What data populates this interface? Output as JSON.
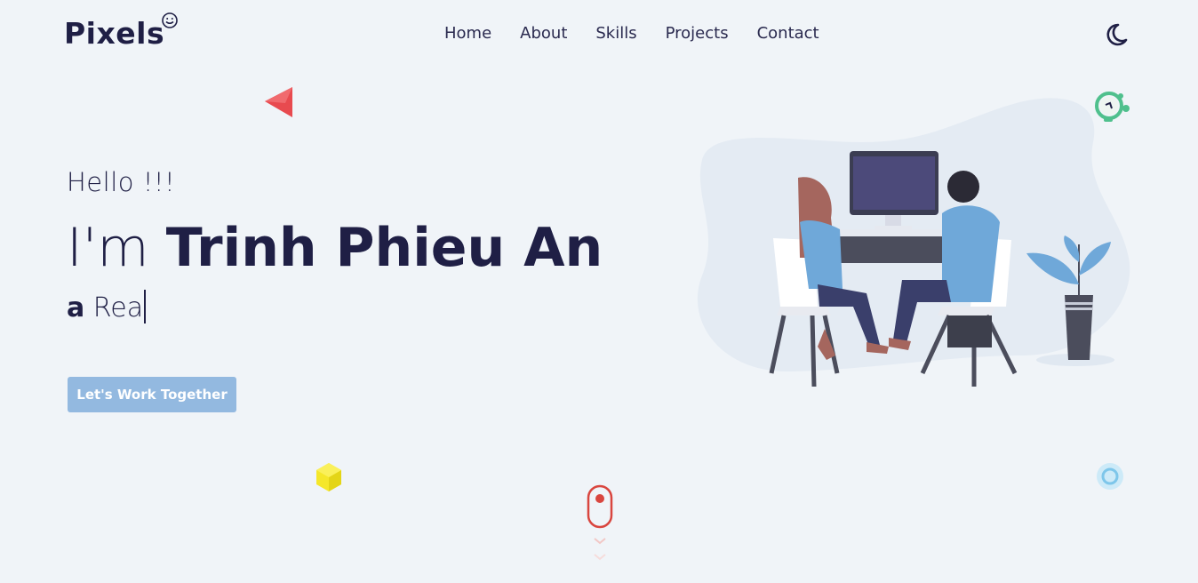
{
  "brand": {
    "name": "Pixels",
    "icon": "smiley-icon"
  },
  "nav": {
    "items": [
      {
        "label": "Home"
      },
      {
        "label": "About"
      },
      {
        "label": "Skills"
      },
      {
        "label": "Projects"
      },
      {
        "label": "Contact"
      }
    ]
  },
  "theme_toggle": {
    "icon": "moon-icon"
  },
  "hero": {
    "greeting": "Hello !!!",
    "intro_prefix": "I'm ",
    "name": "Trinh Phieu An",
    "role_prefix": "a",
    "role_typed": " Rea",
    "cta_label": "Let's Work Together"
  },
  "colors": {
    "background": "#f0f4f8",
    "text": "#1f1f45",
    "accent": "#93b9e0",
    "triangle": "#e84a4f",
    "cube": "#f5e72a",
    "alarm": "#4fc08d",
    "ring": "#a8d8f0",
    "mouse": "#d9463f"
  }
}
